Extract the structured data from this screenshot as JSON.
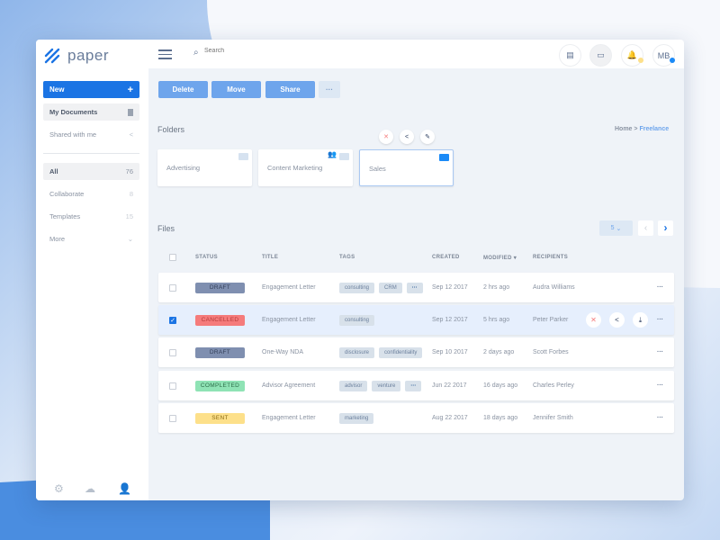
{
  "app": {
    "logo": "paper"
  },
  "sidebar": {
    "new_label": "New",
    "new_icon": "+",
    "items": [
      {
        "label": "My Documents"
      },
      {
        "label": "Shared with me"
      }
    ],
    "filters": [
      {
        "label": "All",
        "count": "76"
      },
      {
        "label": "Collaborate",
        "count": "8"
      },
      {
        "label": "Templates",
        "count": "15"
      },
      {
        "label": "More"
      }
    ]
  },
  "header": {
    "search_placeholder": "Search",
    "avatar": "MB"
  },
  "actions": {
    "delete": "Delete",
    "move": "Move",
    "share": "Share",
    "more": "···"
  },
  "folders": {
    "title": "Folders",
    "breadcrumb": {
      "home": "Home",
      "current": "Freelance"
    },
    "items": [
      "Advertising",
      "Content Marketing",
      "Sales"
    ]
  },
  "files": {
    "title": "Files",
    "page_size": "5",
    "columns": [
      "STATUS",
      "TITLE",
      "TAGS",
      "CREATED",
      "MODIFIED",
      "RECIPIENTS"
    ],
    "rows": [
      {
        "checked": false,
        "status": "DRAFT",
        "title": "Engagement Letter",
        "tags": [
          "consulting",
          "CRM",
          "···"
        ],
        "created": "Sep 12 2017",
        "modified": "2 hrs ago",
        "recipient": "Audra Williams"
      },
      {
        "checked": true,
        "status": "CANCELLED",
        "title": "Engagement Letter",
        "tags": [
          "consulting"
        ],
        "created": "Sep 12 2017",
        "modified": "5 hrs ago",
        "recipient": "Peter Parker"
      },
      {
        "checked": false,
        "status": "DRAFT",
        "title": "One-Way NDA",
        "tags": [
          "disclosure",
          "confidentiality"
        ],
        "created": "Sep 10 2017",
        "modified": "2 days ago",
        "recipient": "Scott Forbes"
      },
      {
        "checked": false,
        "status": "COMPLETED",
        "title": "Advisor Agreement",
        "tags": [
          "advisor",
          "venture",
          "···"
        ],
        "created": "Jun 22 2017",
        "modified": "16 days ago",
        "recipient": "Charles Perley"
      },
      {
        "checked": false,
        "status": "SENT",
        "title": "Engagement Letter",
        "tags": [
          "marketing"
        ],
        "created": "Aug 22 2017",
        "modified": "18 days ago",
        "recipient": "Jennifer Smith"
      }
    ]
  },
  "colors": {
    "accent": "#1b74e4",
    "DRAFT": "#7f8fb0",
    "CANCELLED": "#f57b7b",
    "COMPLETED": "#8fe3b5",
    "SENT": "#fde08a"
  }
}
